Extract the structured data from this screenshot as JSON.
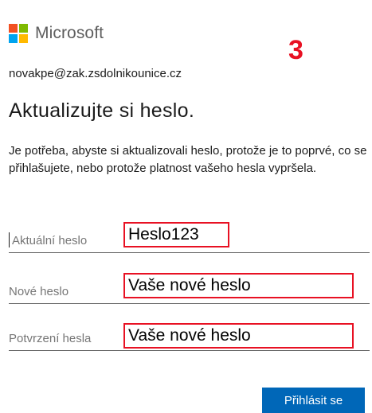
{
  "brand": {
    "name": "Microsoft",
    "logo_colors": [
      "#f25022",
      "#7fba00",
      "#00a4ef",
      "#ffb900"
    ]
  },
  "annotation": {
    "step": "3",
    "color": "#e81123"
  },
  "account": {
    "email": "novakpe@zak.zsdolnikounice.cz"
  },
  "page": {
    "title": "Aktualizujte si heslo.",
    "description": "Je potřeba, abyste si aktualizovali heslo, protože je to poprvé, co se přihlašujete, nebo protože platnost vašeho hesla vypršela."
  },
  "fields": [
    {
      "placeholder": "Aktuální heslo",
      "annotation_value": "Heslo123"
    },
    {
      "placeholder": "Nové heslo",
      "annotation_value": "Vaše nové heslo"
    },
    {
      "placeholder": "Potvrzení hesla",
      "annotation_value": "Vaše nové heslo"
    }
  ],
  "submit": {
    "label": "Přihlásit se",
    "color": "#0067b8"
  }
}
